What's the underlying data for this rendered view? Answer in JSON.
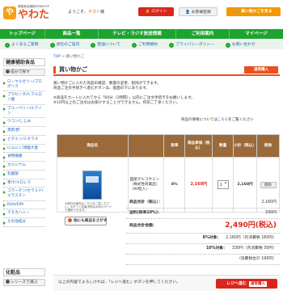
{
  "header": {
    "logo_tagline": "健康食品通販WEBSHOP",
    "logo_mark": "や",
    "logo_name": "やわた",
    "welcome_prefix": "ようこそ、",
    "welcome_guest": "ゲスト",
    "welcome_suffix": "様",
    "login_label": "ログイン",
    "register_label": "お客様登録",
    "cart_label": "買い物かごを見る"
  },
  "nav": {
    "items": [
      "トップページ",
      "商品一覧",
      "テレビ・ラジオ放送情報",
      "ご利用案内",
      "マイページ"
    ]
  },
  "subnav": {
    "items": [
      "よくあるご質問",
      "会社のご案内",
      "配送について",
      "ご利用規約",
      "プライバシーポリシー",
      "お問い合わせ"
    ]
  },
  "sidebar": {
    "heading": "健康補助食品",
    "sub": "成分で探す",
    "items": [
      "ローヤルゼリー/プロポリス",
      "プラセンタ/ヒアルロン酸",
      "ブルーベリー/ルテイン",
      "ウコン/しじみ",
      "黒酢/酢",
      "ビタミン/ミネラル",
      "にんにく/黒酸大麦",
      "食物繊維",
      "カルシウム",
      "乳酸菌",
      "青汁/クロレラ",
      "コラーゲン/セラミド/エラスチン",
      "DHA/EPA",
      "マヌカハニー",
      "その他成分"
    ],
    "cosme_heading": "化粧品",
    "cosme_sub": "シリーズで選ぶ"
  },
  "breadcrumb": {
    "home": "TOP",
    "sep": " > ",
    "current": "買い物かご"
  },
  "page": {
    "title": "買い物かご",
    "proceed_label": "通常購入",
    "intro_line1": "買い物かごに入れた商品の確認、数量の変更、削除ができます。",
    "intro_line2": "商品ご注文手続きへ進むボタンは、画面の下にあります。",
    "intro_line3": "※商品をカートに入れてから「60分（1時間）」以内にご注文手続きをお願いします。",
    "intro_line4": "※10円以上のご注文はお受けすることができません。何卒ご了承ください。",
    "shop_note_prefix": "商品の価格については",
    "shop_note_link": "こちら",
    "shop_note_suffix": "をご覧ください"
  },
  "table": {
    "headers": [
      "商品名",
      "",
      "税率",
      "商品単価（税込）",
      "数量",
      "小計（税込）",
      "削除"
    ],
    "rows": [
      {
        "name": "国産グルコサミン（株式性商業品）（90粒入）",
        "rate": "8%",
        "unit_price": "2,160円",
        "qty": "1",
        "subtotal": "2,160円",
        "delete": "削除"
      }
    ]
  },
  "notes": {
    "small": "※送料の案内はこちらをご覧ください。※ギフト包装(有料)は次のページで選択できます。",
    "more_button": "他にも商品をさがす"
  },
  "totals": {
    "rows": [
      {
        "k": "商品合計（税込）：",
        "v": "2,160円"
      },
      {
        "k": "送料(税率10%)：",
        "v": "330円"
      }
    ],
    "grand_label": "商品合計金額：",
    "grand_value": "2,490円(税込)",
    "tax_rows": [
      {
        "k": "8%対象：",
        "v": "2,160円（内消費税 160円）"
      },
      {
        "k": "10%対象：",
        "v": "330円（内消費税 30円）"
      },
      {
        "k": "",
        "v": "（消費税合計 190円）"
      }
    ]
  },
  "bottom": {
    "message": "以上の内容でよろしければ、「レジへ進む」ボタンを押してください。",
    "proceed_label": "レジへ進む",
    "proceed_tag": "通常購入"
  }
}
